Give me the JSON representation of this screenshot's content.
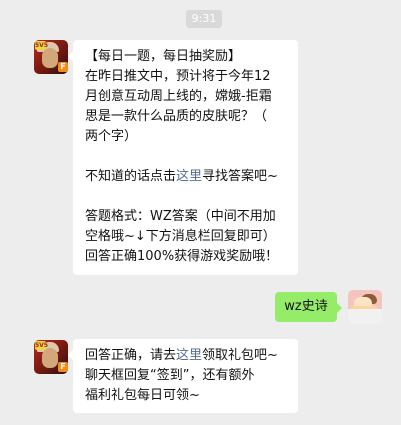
{
  "time": "9:31",
  "avatar": {
    "game_corner": "5V5",
    "game_badge": "F"
  },
  "messages": {
    "incoming_1": {
      "line1": "【每日一题，每日抽奖励】",
      "line2": "在昨日推文中，预计将于今年12",
      "line3": "月创意互动周上线的，嫦娥-拒霜",
      "line4": "思是一款什么品质的皮肤呢？（",
      "line5": "两个字）",
      "hint_prefix": "不知道的话点击",
      "hint_link": "这里",
      "hint_suffix": "寻找答案吧~",
      "format1": "答题格式：WZ答案（中间不用加",
      "format2": "空格哦~↓下方消息栏回复即可）",
      "format3": "回答正确100%获得游戏奖励哦！"
    },
    "outgoing": {
      "text": "wz史诗"
    },
    "incoming_2": {
      "line1_prefix": "回答正确，请去",
      "line1_link": "这里",
      "line1_suffix": "领取礼包吧~",
      "line2": "聊天框回复“签到”，还有额外",
      "line3": "福利礼包每日可领~"
    }
  },
  "colors": {
    "background": "#ededed",
    "bubble_in": "#ffffff",
    "bubble_out": "#95ec69",
    "link": "#576b95"
  }
}
